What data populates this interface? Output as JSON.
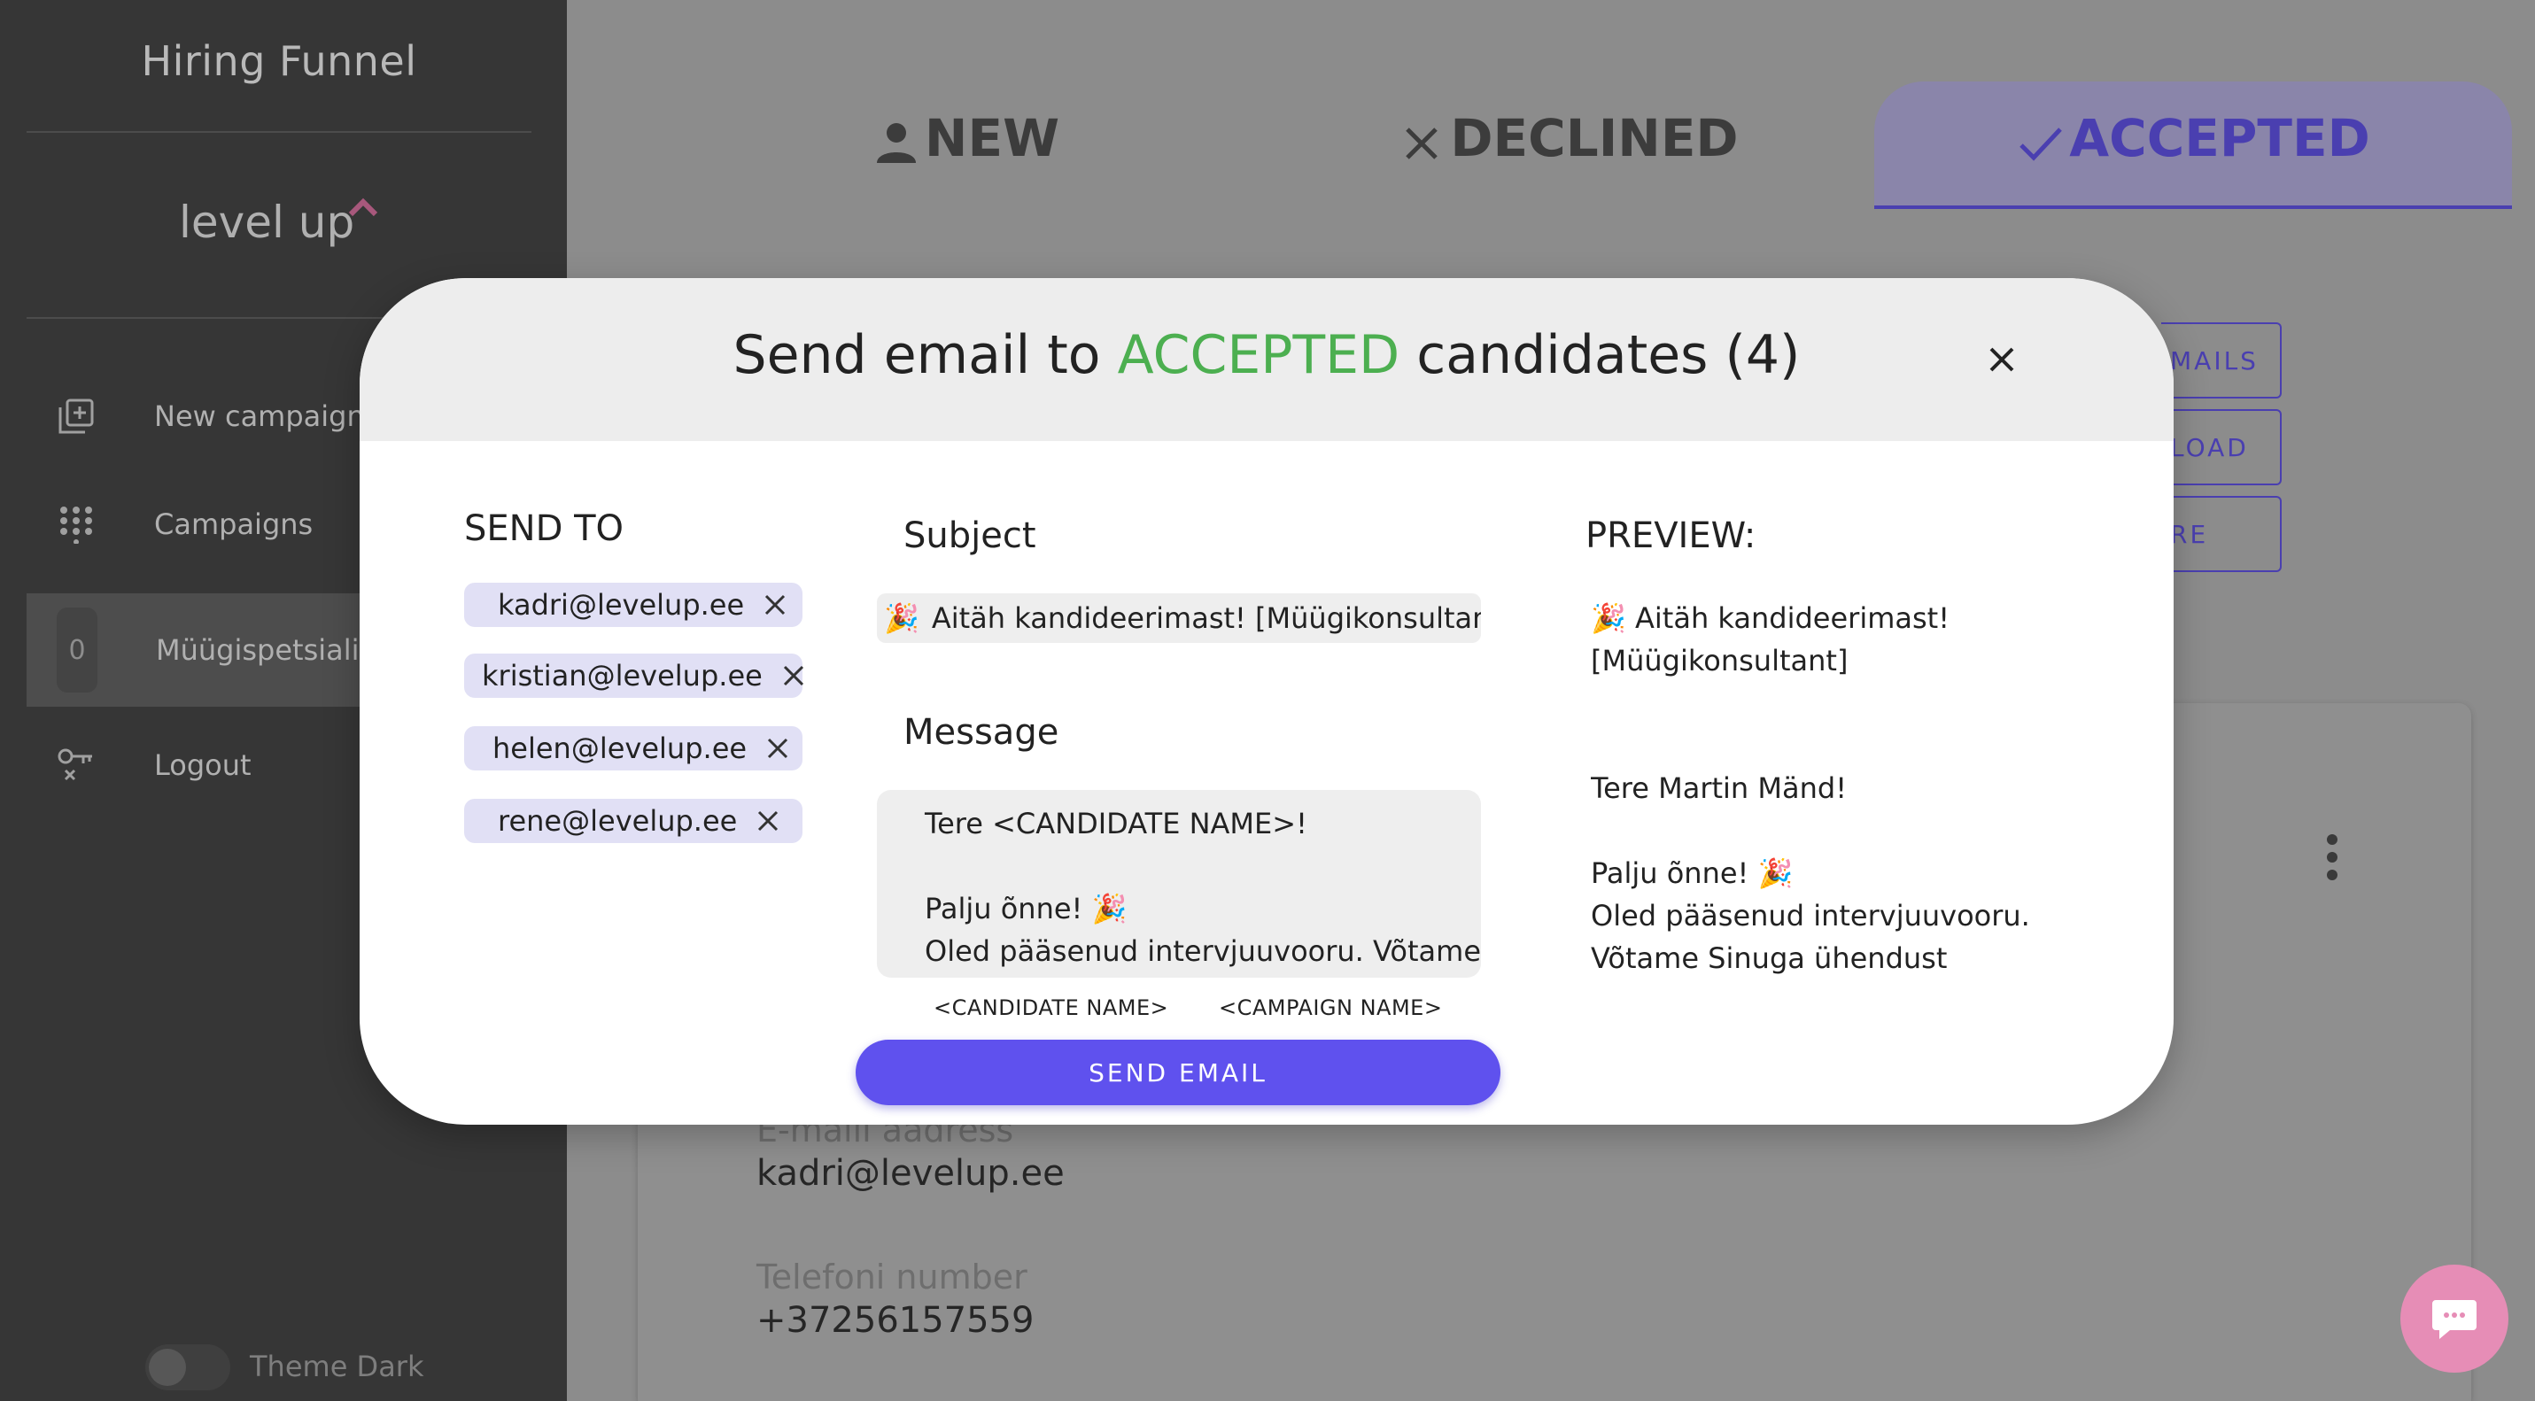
{
  "app": {
    "title": "Hiring Funnel",
    "logo_text": "level up",
    "accent_color": "#5f51ee",
    "accepted_color": "#4caf50"
  },
  "sidebar": {
    "items": [
      {
        "label": "New campaign",
        "icon": "add-box-icon"
      },
      {
        "label": "Campaigns",
        "icon": "grid-dots-icon"
      },
      {
        "label": "Müügispetsialist",
        "count": "0",
        "active": true
      },
      {
        "label": "Logout",
        "icon": "key-icon"
      }
    ],
    "theme_label": "Theme Dark"
  },
  "tabs": [
    {
      "label": "NEW",
      "icon": "person-icon"
    },
    {
      "label": "DECLINED",
      "icon": "close-icon"
    },
    {
      "label": "ACCEPTED",
      "icon": "check-icon",
      "selected": true
    }
  ],
  "side_buttons": [
    "MAILS",
    "LOAD",
    "RE"
  ],
  "card": {
    "email_label": "E-maili aadress",
    "email_value": "kadri@levelup.ee",
    "phone_label": "Telefoni number",
    "phone_value": "+37256157559"
  },
  "modal": {
    "title_prefix": "Send email to",
    "title_status": "ACCEPTED",
    "title_suffix": "candidates (4)",
    "send_to_label": "SEND TO",
    "recipients": [
      "kadri@levelup.ee",
      "kristian@levelup.ee",
      "helen@levelup.ee",
      "rene@levelup.ee"
    ],
    "subject_label": "Subject",
    "subject_emoji": "🎉",
    "subject_value": "Aitäh kandideerimast! [Müügikonsultant]",
    "message_label": "Message",
    "message_lines": [
      "Tere <CANDIDATE NAME>!",
      "",
      "Palju õnne! 🎉",
      "Oled pääsenud intervjuuvooru. Võtame"
    ],
    "tokens": [
      "<CANDIDATE NAME>",
      "<CAMPAIGN NAME>"
    ],
    "send_button": "SEND EMAIL",
    "preview_label": "PREVIEW:",
    "preview_lines": [
      "🎉  Aitäh kandideerimast!",
      "[Müügikonsultant]",
      "",
      "",
      "Tere Martin Mänd!",
      "",
      "Palju õnne! 🎉",
      "Oled pääsenud intervjuuvooru.",
      "Võtame Sinuga ühendust"
    ]
  }
}
